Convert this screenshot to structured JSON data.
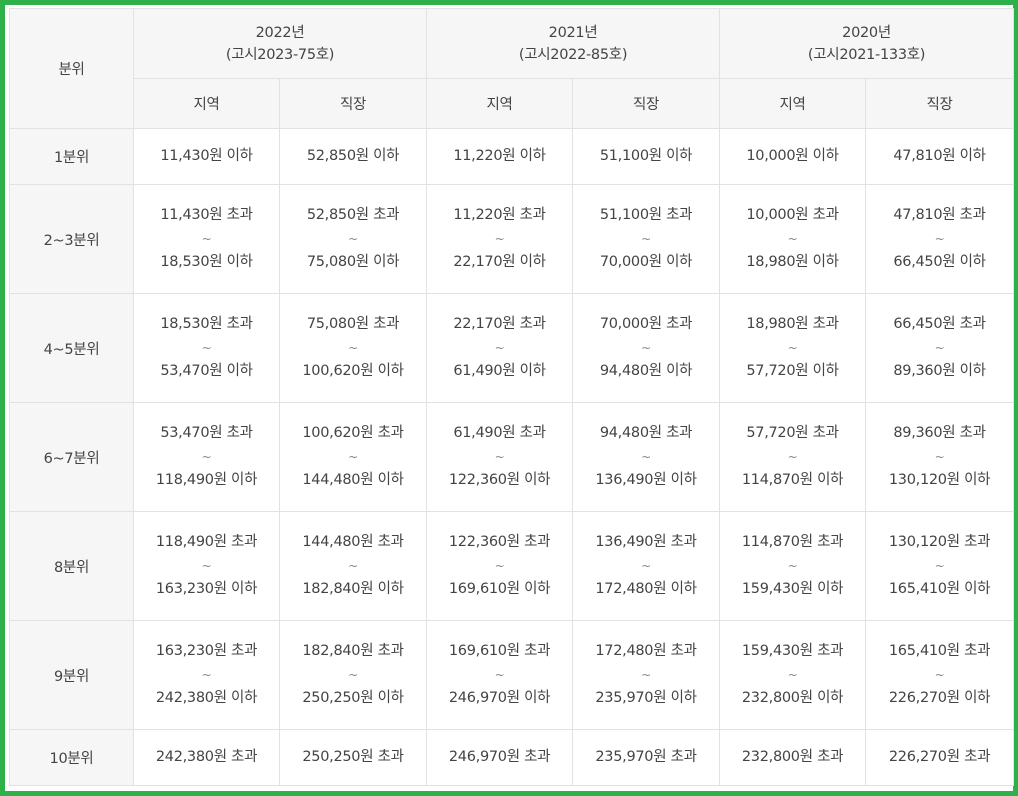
{
  "table": {
    "quintile_header": "분위",
    "years": [
      {
        "year": "2022년",
        "notice": "(고시2023-75호)"
      },
      {
        "year": "2021년",
        "notice": "(고시2022-85호)"
      },
      {
        "year": "2020년",
        "notice": "(고시2021-133호)"
      }
    ],
    "subheaders": [
      "지역",
      "직장",
      "지역",
      "직장",
      "지역",
      "직장"
    ],
    "tilde": "~",
    "rows": [
      {
        "label": "1분위",
        "cells": [
          [
            "11,430원 이하"
          ],
          [
            "52,850원 이하"
          ],
          [
            "11,220원 이하"
          ],
          [
            "51,100원 이하"
          ],
          [
            "10,000원 이하"
          ],
          [
            "47,810원 이하"
          ]
        ]
      },
      {
        "label": "2~3분위",
        "cells": [
          [
            "11,430원 초과",
            "18,530원 이하"
          ],
          [
            "52,850원 초과",
            "75,080원 이하"
          ],
          [
            "11,220원 초과",
            "22,170원 이하"
          ],
          [
            "51,100원 초과",
            "70,000원 이하"
          ],
          [
            "10,000원 초과",
            "18,980원 이하"
          ],
          [
            "47,810원 초과",
            "66,450원 이하"
          ]
        ]
      },
      {
        "label": "4~5분위",
        "cells": [
          [
            "18,530원 초과",
            "53,470원 이하"
          ],
          [
            "75,080원 초과",
            "100,620원 이하"
          ],
          [
            "22,170원 초과",
            "61,490원 이하"
          ],
          [
            "70,000원 초과",
            "94,480원 이하"
          ],
          [
            "18,980원 초과",
            "57,720원 이하"
          ],
          [
            "66,450원 초과",
            "89,360원 이하"
          ]
        ]
      },
      {
        "label": "6~7분위",
        "cells": [
          [
            "53,470원 초과",
            "118,490원 이하"
          ],
          [
            "100,620원 초과",
            "144,480원 이하"
          ],
          [
            "61,490원 초과",
            "122,360원 이하"
          ],
          [
            "94,480원 초과",
            "136,490원 이하"
          ],
          [
            "57,720원 초과",
            "114,870원 이하"
          ],
          [
            "89,360원 초과",
            "130,120원 이하"
          ]
        ]
      },
      {
        "label": "8분위",
        "cells": [
          [
            "118,490원 초과",
            "163,230원 이하"
          ],
          [
            "144,480원 초과",
            "182,840원 이하"
          ],
          [
            "122,360원 초과",
            "169,610원 이하"
          ],
          [
            "136,490원 초과",
            "172,480원 이하"
          ],
          [
            "114,870원 초과",
            "159,430원 이하"
          ],
          [
            "130,120원 초과",
            "165,410원 이하"
          ]
        ]
      },
      {
        "label": "9분위",
        "cells": [
          [
            "163,230원 초과",
            "242,380원 이하"
          ],
          [
            "182,840원 초과",
            "250,250원 이하"
          ],
          [
            "169,610원 초과",
            "246,970원 이하"
          ],
          [
            "172,480원 초과",
            "235,970원 이하"
          ],
          [
            "159,430원 초과",
            "232,800원 이하"
          ],
          [
            "165,410원 초과",
            "226,270원 이하"
          ]
        ]
      },
      {
        "label": "10분위",
        "cells": [
          [
            "242,380원 초과"
          ],
          [
            "250,250원 초과"
          ],
          [
            "246,970원 초과"
          ],
          [
            "235,970원 초과"
          ],
          [
            "232,800원 초과"
          ],
          [
            "226,270원 초과"
          ]
        ]
      }
    ]
  },
  "colors": {
    "frame_border": "#2fb14a",
    "header_bg": "#f6f6f6",
    "grid_line": "#e2e2e2",
    "text": "#444444"
  }
}
